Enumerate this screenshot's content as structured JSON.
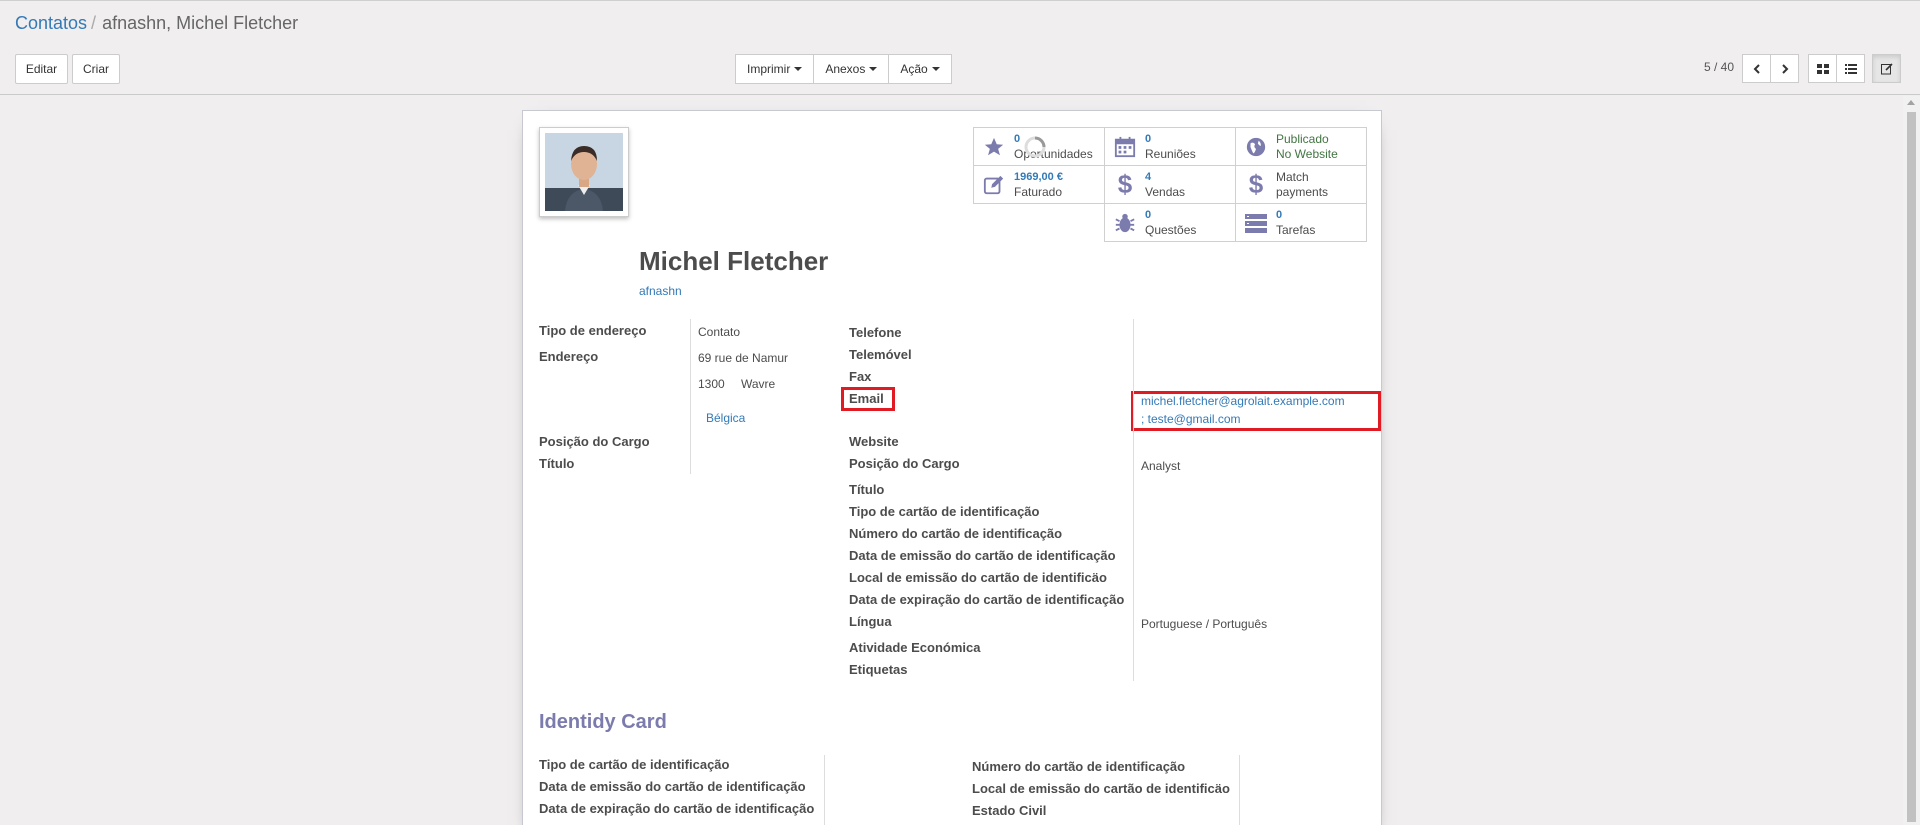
{
  "breadcrumb": {
    "parent": "Contatos",
    "separator": "/",
    "current": "afnashn, Michel Fletcher"
  },
  "buttons": {
    "edit": "Editar",
    "create": "Criar",
    "print": "Imprimir",
    "attachments": "Anexos",
    "action": "Ação"
  },
  "pager": {
    "text": "5 / 40"
  },
  "stats": {
    "opportunities": {
      "count": "0",
      "label": "Oportunidades"
    },
    "meetings": {
      "count": "0",
      "label": "Reuniões"
    },
    "website": {
      "line1": "Publicado",
      "line2": "No Website"
    },
    "invoiced": {
      "count": "1969,00 €",
      "label": "Faturado"
    },
    "sales": {
      "count": "4",
      "label": "Vendas"
    },
    "payments": {
      "line1": "Match",
      "line2": "payments"
    },
    "issues": {
      "count": "0",
      "label": "Questões"
    },
    "tasks": {
      "count": "0",
      "label": "Tarefas"
    }
  },
  "contact": {
    "name": "Michel Fletcher",
    "company": "afnashn"
  },
  "left_fields": {
    "address_type_label": "Tipo de endereço",
    "address_type_value": "Contato",
    "address_label": "Endereço",
    "street": "69 rue de Namur",
    "zip": "1300",
    "city": "Wavre",
    "country": "Bélgica",
    "job_position_label": "Posição do Cargo",
    "title_label": "Título"
  },
  "right_fields": {
    "phone_label": "Telefone",
    "mobile_label": "Telemóvel",
    "fax_label": "Fax",
    "email_label": "Email",
    "email_value_1": "michel.fletcher@agrolait.example.com",
    "email_value_2": "; teste@gmail.com",
    "website_label": "Website",
    "job_position_label": "Posição do Cargo",
    "job_position_value": "Analyst",
    "title_label": "Título",
    "id_type_label": "Tipo de cartão de identificação",
    "id_number_label": "Número do cartão de identificação",
    "id_issue_date_label": "Data de emissão do cartão de identificação",
    "id_issue_place_label": "Local de emissão do cartão de identificäo",
    "id_expiry_label": "Data de expiração do cartão de identificação",
    "language_label": "Língua",
    "language_value": "Portuguese / Português",
    "economic_activity_label": "Atividade Económica",
    "tags_label": "Etiquetas"
  },
  "identity_card": {
    "title": "Identidy Card",
    "left": {
      "type_label": "Tipo de cartão de identificação",
      "issue_date_label": "Data de emissão do cartão de identificação",
      "expiry_label": "Data de expiração do cartão de identificação"
    },
    "right": {
      "number_label": "Número do cartão de identificação",
      "issue_place_label": "Local de emissão do cartão de identificäo",
      "marital_label": "Estado Civil"
    }
  },
  "colors": {
    "link": "#337ab7",
    "highlight": "#e01b24",
    "section_title": "#7c7bad",
    "icon": "#7c7bad"
  }
}
